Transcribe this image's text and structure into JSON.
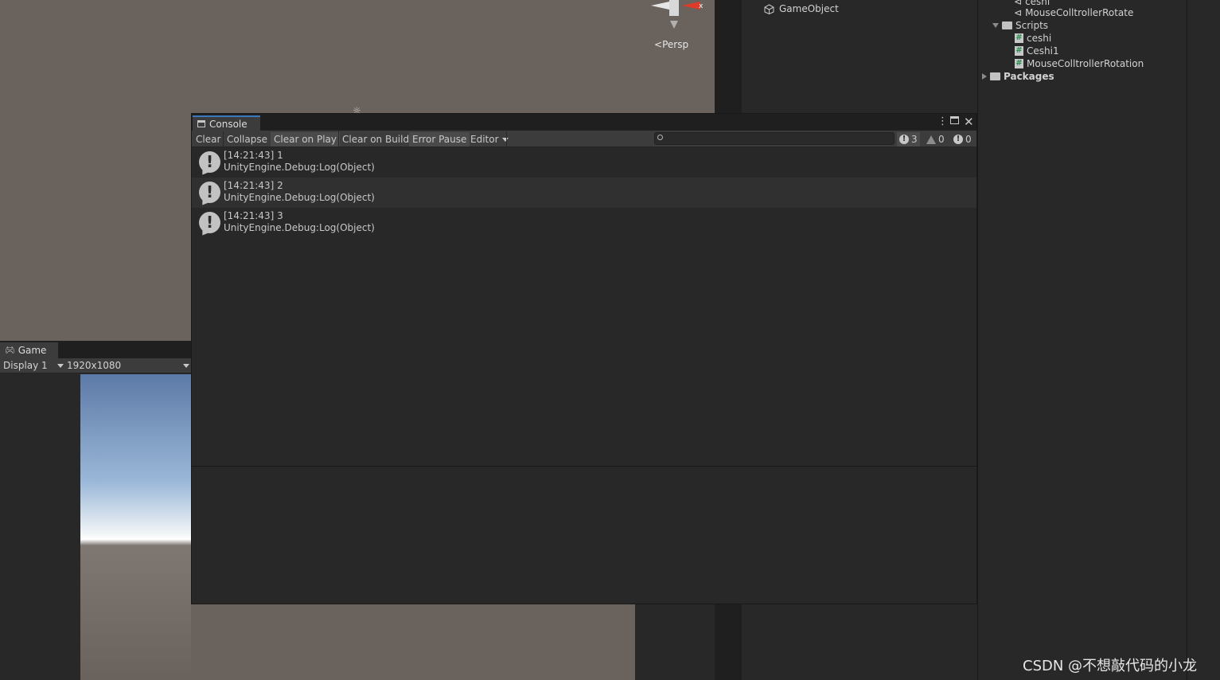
{
  "scene": {
    "persp_label": "Persp",
    "gizmo_axis": "x"
  },
  "hierarchy": {
    "items": [
      {
        "label": "GameObject",
        "icon": "cube-icon"
      }
    ]
  },
  "project": {
    "rows": [
      {
        "label": "ceshi",
        "icon": "prefab-icon"
      },
      {
        "label": "MouseColltrollerRotate",
        "icon": "prefab-icon"
      },
      {
        "label": "Scripts",
        "icon": "folder-icon"
      },
      {
        "label": "ceshi",
        "icon": "script-icon"
      },
      {
        "label": "Ceshi1",
        "icon": "script-icon"
      },
      {
        "label": "MouseColltrollerRotation",
        "icon": "script-icon"
      },
      {
        "label": "Packages",
        "icon": "folder-icon"
      }
    ]
  },
  "game": {
    "tab_label": "Game",
    "display": "Display 1",
    "resolution": "1920x1080"
  },
  "console": {
    "tab_label": "Console",
    "toolbar": {
      "clear": "Clear",
      "collapse": "Collapse",
      "clear_on_play": "Clear on Play",
      "clear_on_build": "Clear on Build",
      "error_pause": "Error Pause",
      "editor": "Editor"
    },
    "search": {
      "placeholder": ""
    },
    "counts": {
      "log": "3",
      "warning": "0",
      "error": "0"
    },
    "logs": [
      {
        "line1": "[14:21:43] 1",
        "line2": "UnityEngine.Debug:Log(Object)"
      },
      {
        "line1": "[14:21:43] 2",
        "line2": "UnityEngine.Debug:Log(Object)"
      },
      {
        "line1": "[14:21:43] 3",
        "line2": "UnityEngine.Debug:Log(Object)"
      }
    ]
  },
  "watermark": "CSDN @不想敲代码的小龙"
}
